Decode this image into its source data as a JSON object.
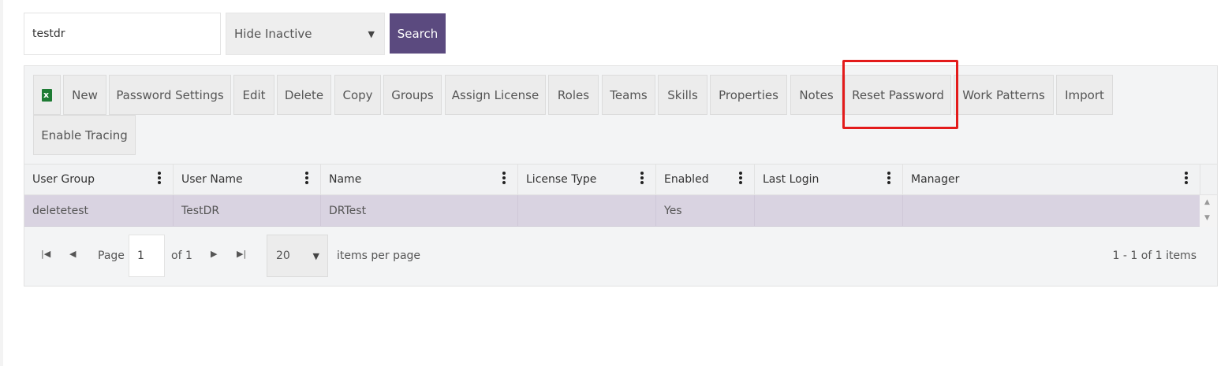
{
  "search": {
    "value": "testdr",
    "filter_selected": "Hide Inactive",
    "button_label": "Search"
  },
  "toolbar": {
    "export_icon": "excel-icon",
    "buttons": [
      "New",
      "Password Settings",
      "Edit",
      "Delete",
      "Copy",
      "Groups",
      "Assign License",
      "Roles",
      "Teams",
      "Skills",
      "Properties",
      "Notes",
      "Reset Password",
      "Work Patterns",
      "Import",
      "Enable Tracing"
    ]
  },
  "highlight_color": "#e31b1b",
  "accent_color": "#5b4a7f",
  "columns": [
    "User Group",
    "User Name",
    "Name",
    "License Type",
    "Enabled",
    "Last Login",
    "Manager"
  ],
  "rows": [
    [
      "deletetest",
      "TestDR",
      "DRTest",
      "",
      "Yes",
      "",
      ""
    ]
  ],
  "pager": {
    "page_label": "Page",
    "page_value": "1",
    "of_label": "of 1",
    "page_size": "20",
    "items_per_page_label": "items per page",
    "summary": "1 - 1 of 1 items"
  }
}
